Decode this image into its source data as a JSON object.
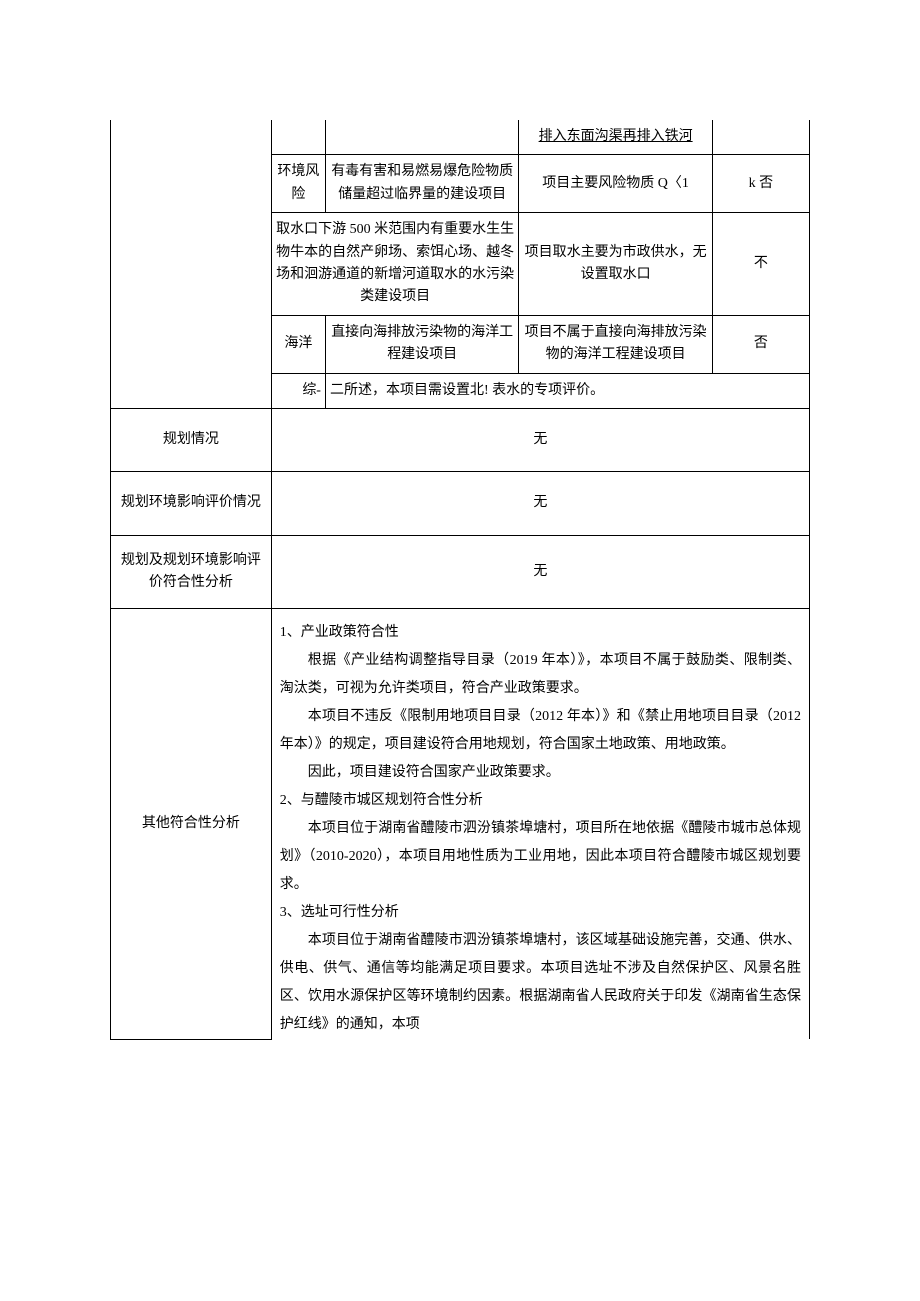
{
  "inner_table": {
    "row0": {
      "c2": "排入东面沟渠再排入铁河"
    },
    "row1": {
      "c0": "环境风险",
      "c1": "有毒有害和易燃易爆危险物质储量超过临界量的建设项目",
      "c2": "项目主要风险物质 Q〈1",
      "c3": "k 否"
    },
    "row2": {
      "c1": "取水口下游 500 米范围内有重要水生生物牛本的自然产卵场、索饵心场、越冬场和洄游通道的新增河道取水的水污染类建设项目",
      "c2": "项目取水主要为市政供水，无设置取水口",
      "c3": "不"
    },
    "row3": {
      "c0": "海洋",
      "c1": "直接向海排放污染物的海洋工程建设项目",
      "c2": "项目不属于直接向海排放污染物的海洋工程建设项目",
      "c3": "否"
    },
    "row4": {
      "pre": "综-",
      "text": "二所述，本项目需设置北! 表水的专项评价。"
    }
  },
  "rows": {
    "planning": {
      "label": "规划情况",
      "value": "无"
    },
    "eia": {
      "label": "规划环境影响评价情况",
      "value": "无"
    },
    "compliance": {
      "label": "规划及规划环境影响评价符合性分析",
      "value": "无"
    },
    "other": {
      "label": "其他符合性分析"
    }
  },
  "other_body": {
    "h1": "1、产业政策符合性",
    "p1": "根据《产业结构调整指导目录（2019 年本）》，本项目不属于鼓励类、限制类、淘汰类，可视为允许类项目，符合产业政策要求。",
    "p2": "本项目不违反《限制用地项目目录（2012 年本）》和《禁止用地项目目录（2012 年本）》的规定，项目建设符合用地规划，符合国家土地政策、用地政策。",
    "p3": "因此，项目建设符合国家产业政策要求。",
    "h2": "2、与醴陵市城区规划符合性分析",
    "p4": "本项目位于湖南省醴陵市泗汾镇茶埠塘村，项目所在地依据《醴陵市城市总体规划》（2010-2020），本项目用地性质为工业用地，因此本项目符合醴陵市城区规划要求。",
    "h3": "3、选址可行性分析",
    "p5": "本项目位于湖南省醴陵市泗汾镇茶埠塘村，该区域基础设施完善，交通、供水、供电、供气、通信等均能满足项目要求。本项目选址不涉及自然保护区、风景名胜区、饮用水源保护区等环境制约因素。根据湖南省人民政府关于印发《湖南省生态保护红线》的通知，本项"
  }
}
